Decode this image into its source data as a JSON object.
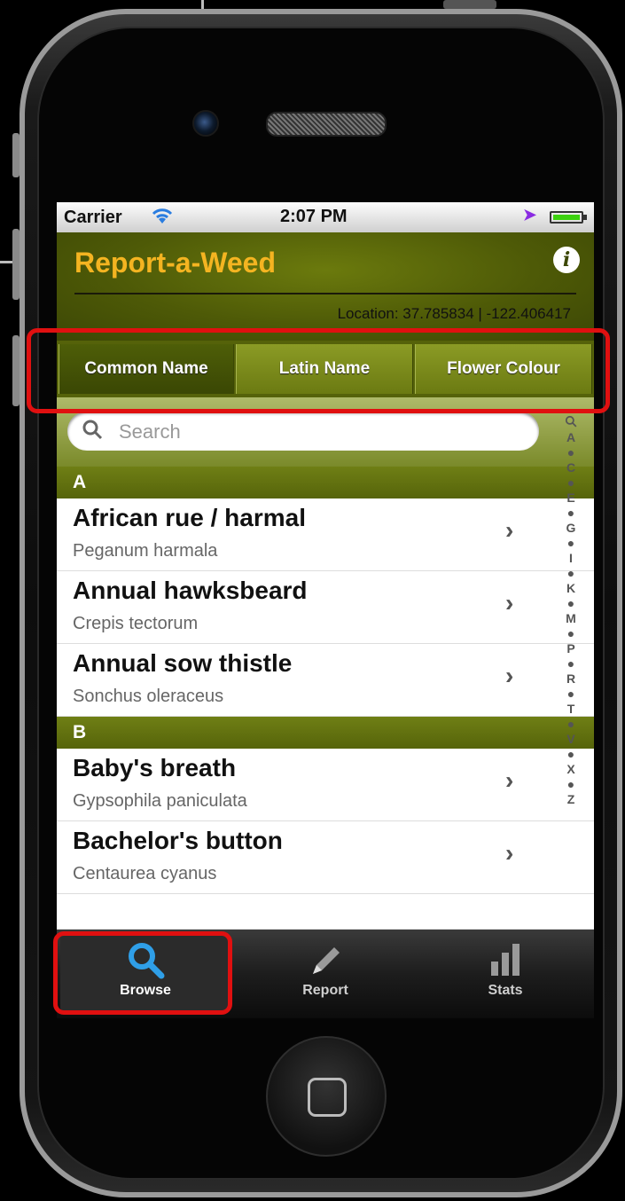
{
  "status_bar": {
    "carrier": "Carrier",
    "time": "2:07 PM"
  },
  "app": {
    "title": "Report-a-Weed",
    "info_icon": "i",
    "location": "Location: 37.785834 | -122.406417"
  },
  "segments": [
    "Common Name",
    "Latin Name",
    "Flower Colour"
  ],
  "search": {
    "placeholder": "Search"
  },
  "index_letters": [
    "A",
    "●",
    "C",
    "●",
    "E",
    "●",
    "G",
    "●",
    "I",
    "●",
    "K",
    "●",
    "M",
    "●",
    "P",
    "●",
    "R",
    "●",
    "T",
    "●",
    "V",
    "●",
    "X",
    "●",
    "Z"
  ],
  "sections": [
    {
      "letter": "A",
      "items": [
        {
          "name": "African rue / harmal",
          "latin": "Peganum harmala"
        },
        {
          "name": "Annual hawksbeard",
          "latin": "Crepis tectorum"
        },
        {
          "name": "Annual sow thistle",
          "latin": "Sonchus oleraceus"
        }
      ]
    },
    {
      "letter": "B",
      "items": [
        {
          "name": "Baby's breath",
          "latin": "Gypsophila paniculata"
        },
        {
          "name": "Bachelor's button",
          "latin": "Centaurea cyanus"
        }
      ]
    }
  ],
  "tabs": [
    {
      "label": "Browse",
      "icon": "search-icon"
    },
    {
      "label": "Report",
      "icon": "pencil-icon"
    },
    {
      "label": "Stats",
      "icon": "bar-chart-icon"
    }
  ],
  "colors": {
    "title": "#f4b421",
    "header_green": "#4e5a07",
    "highlight": "#e01010"
  }
}
